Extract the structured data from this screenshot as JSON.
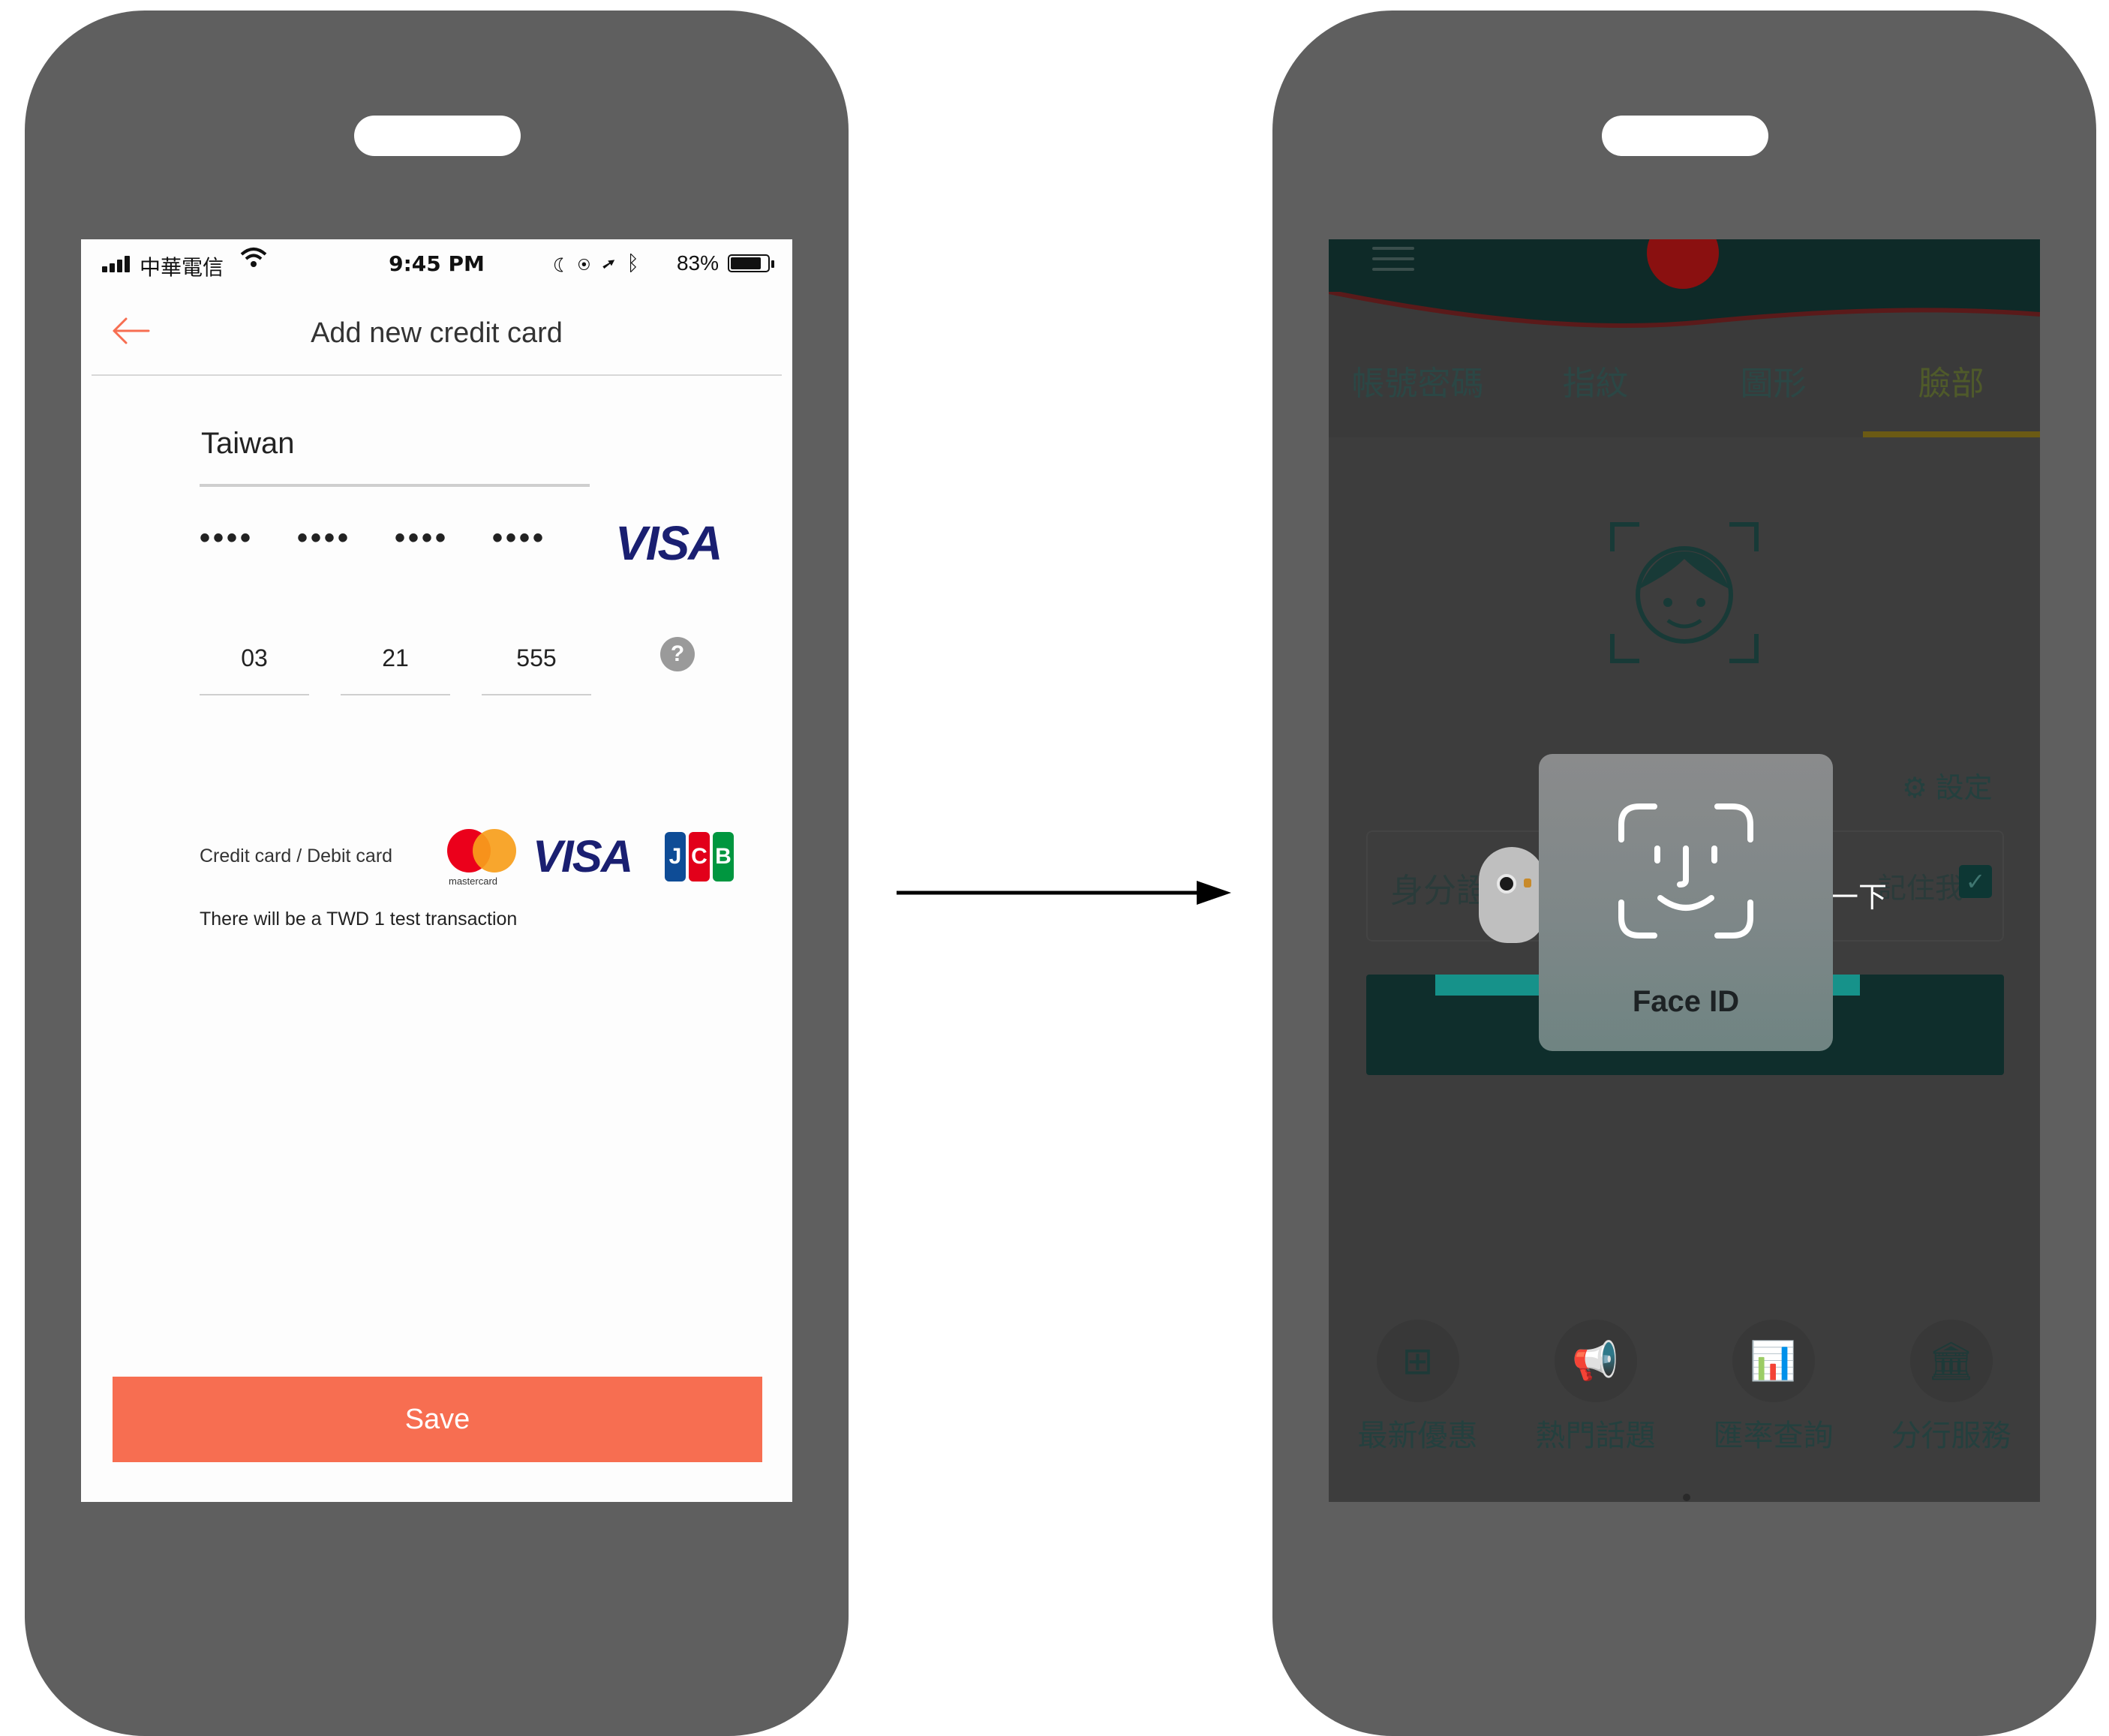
{
  "left_screen": {
    "status": {
      "carrier": "中華電信",
      "time": "9:45 PM",
      "battery": "83%",
      "battery_level": 0.83
    },
    "nav": {
      "title": "Add new credit card",
      "back_icon": "arrow-left-icon"
    },
    "form": {
      "country": "Taiwan",
      "card_number_groups": [
        "••••",
        "••••",
        "••••",
        "••••"
      ],
      "card_brand": "VISA",
      "expiry_month": "03",
      "expiry_year": "21",
      "cvv": "555",
      "help_glyph": "?"
    },
    "payment_info": {
      "card_types": "Credit card / Debit card",
      "mastercard_label": "mastercard",
      "visa_label": "VISA",
      "jcb_label": "JCB",
      "note": "There will be a TWD 1 test transaction"
    },
    "save_label": "Save",
    "accent_color": "#f76e51"
  },
  "right_screen": {
    "tabs": [
      "帳號密碼",
      "指紋",
      "圖形",
      "臉部"
    ],
    "active_tab": 3,
    "settings_label": "設定",
    "id_label": "身分證",
    "remember_label": "記住我",
    "behind_text": "一下",
    "faceid_label": "Face ID",
    "bottom_nav": [
      {
        "label": "最新優惠",
        "icon": "gift-icon"
      },
      {
        "label": "熱門話題",
        "icon": "megaphone-icon"
      },
      {
        "label": "匯率查詢",
        "icon": "bar-chart-icon"
      },
      {
        "label": "分行服務",
        "icon": "bank-icon"
      }
    ],
    "theme_color": "#0e2a28",
    "teal_color": "#16928a"
  }
}
